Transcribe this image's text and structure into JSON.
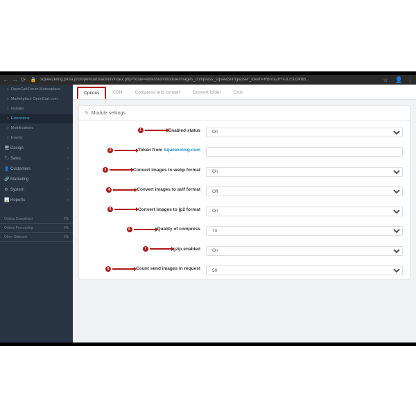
{
  "browser": {
    "url": "squeezeimg.pinta.pro/opencart3/admin/index.php?route=extension/module/images_compress_squeezeimg&user_token=RBroxZlFmJLE9ZWbB..."
  },
  "sidebar": {
    "sub_items": [
      "OpenCartForum Marketplace",
      "Marketplace OpenCart.com",
      "Installer",
      "Extensions",
      "Modifications",
      "Events"
    ],
    "main_items": [
      {
        "icon": "🖥",
        "label": "Design"
      },
      {
        "icon": "🏷",
        "label": "Sales"
      },
      {
        "icon": "👤",
        "label": "Customers"
      },
      {
        "icon": "🔗",
        "label": "Marketing"
      },
      {
        "icon": "⚙",
        "label": "System"
      },
      {
        "icon": "📊",
        "label": "Reports"
      }
    ],
    "stats": [
      {
        "label": "Orders Completed",
        "value": "0%"
      },
      {
        "label": "Orders Processing",
        "value": "0%"
      },
      {
        "label": "Other Statuses",
        "value": "0%"
      }
    ]
  },
  "tabs": [
    "Options",
    "CDN",
    "Compress and convert",
    "Convert folder",
    "Cron"
  ],
  "panel_title": "Module settings",
  "link_text": "Squeezeimg.com",
  "rows": [
    {
      "n": "1",
      "label": "Enabled status",
      "type": "select",
      "value": "On"
    },
    {
      "n": "2",
      "label": "Token from ",
      "type": "input",
      "value": "",
      "link": true
    },
    {
      "n": "3",
      "label": "Convert images to webp format",
      "type": "select",
      "value": "On"
    },
    {
      "n": "4",
      "label": "Convert images to avif format",
      "type": "select",
      "value": "Off"
    },
    {
      "n": "5",
      "label": "Convert images to jp2 format",
      "type": "select",
      "value": "On"
    },
    {
      "n": "6",
      "label": "Quality of compress",
      "type": "select",
      "value": "70"
    },
    {
      "n": "7",
      "label": "gzip enabled",
      "type": "select",
      "value": "On"
    },
    {
      "n": "8",
      "label": "Count send images in request",
      "type": "select",
      "value": "50"
    }
  ]
}
